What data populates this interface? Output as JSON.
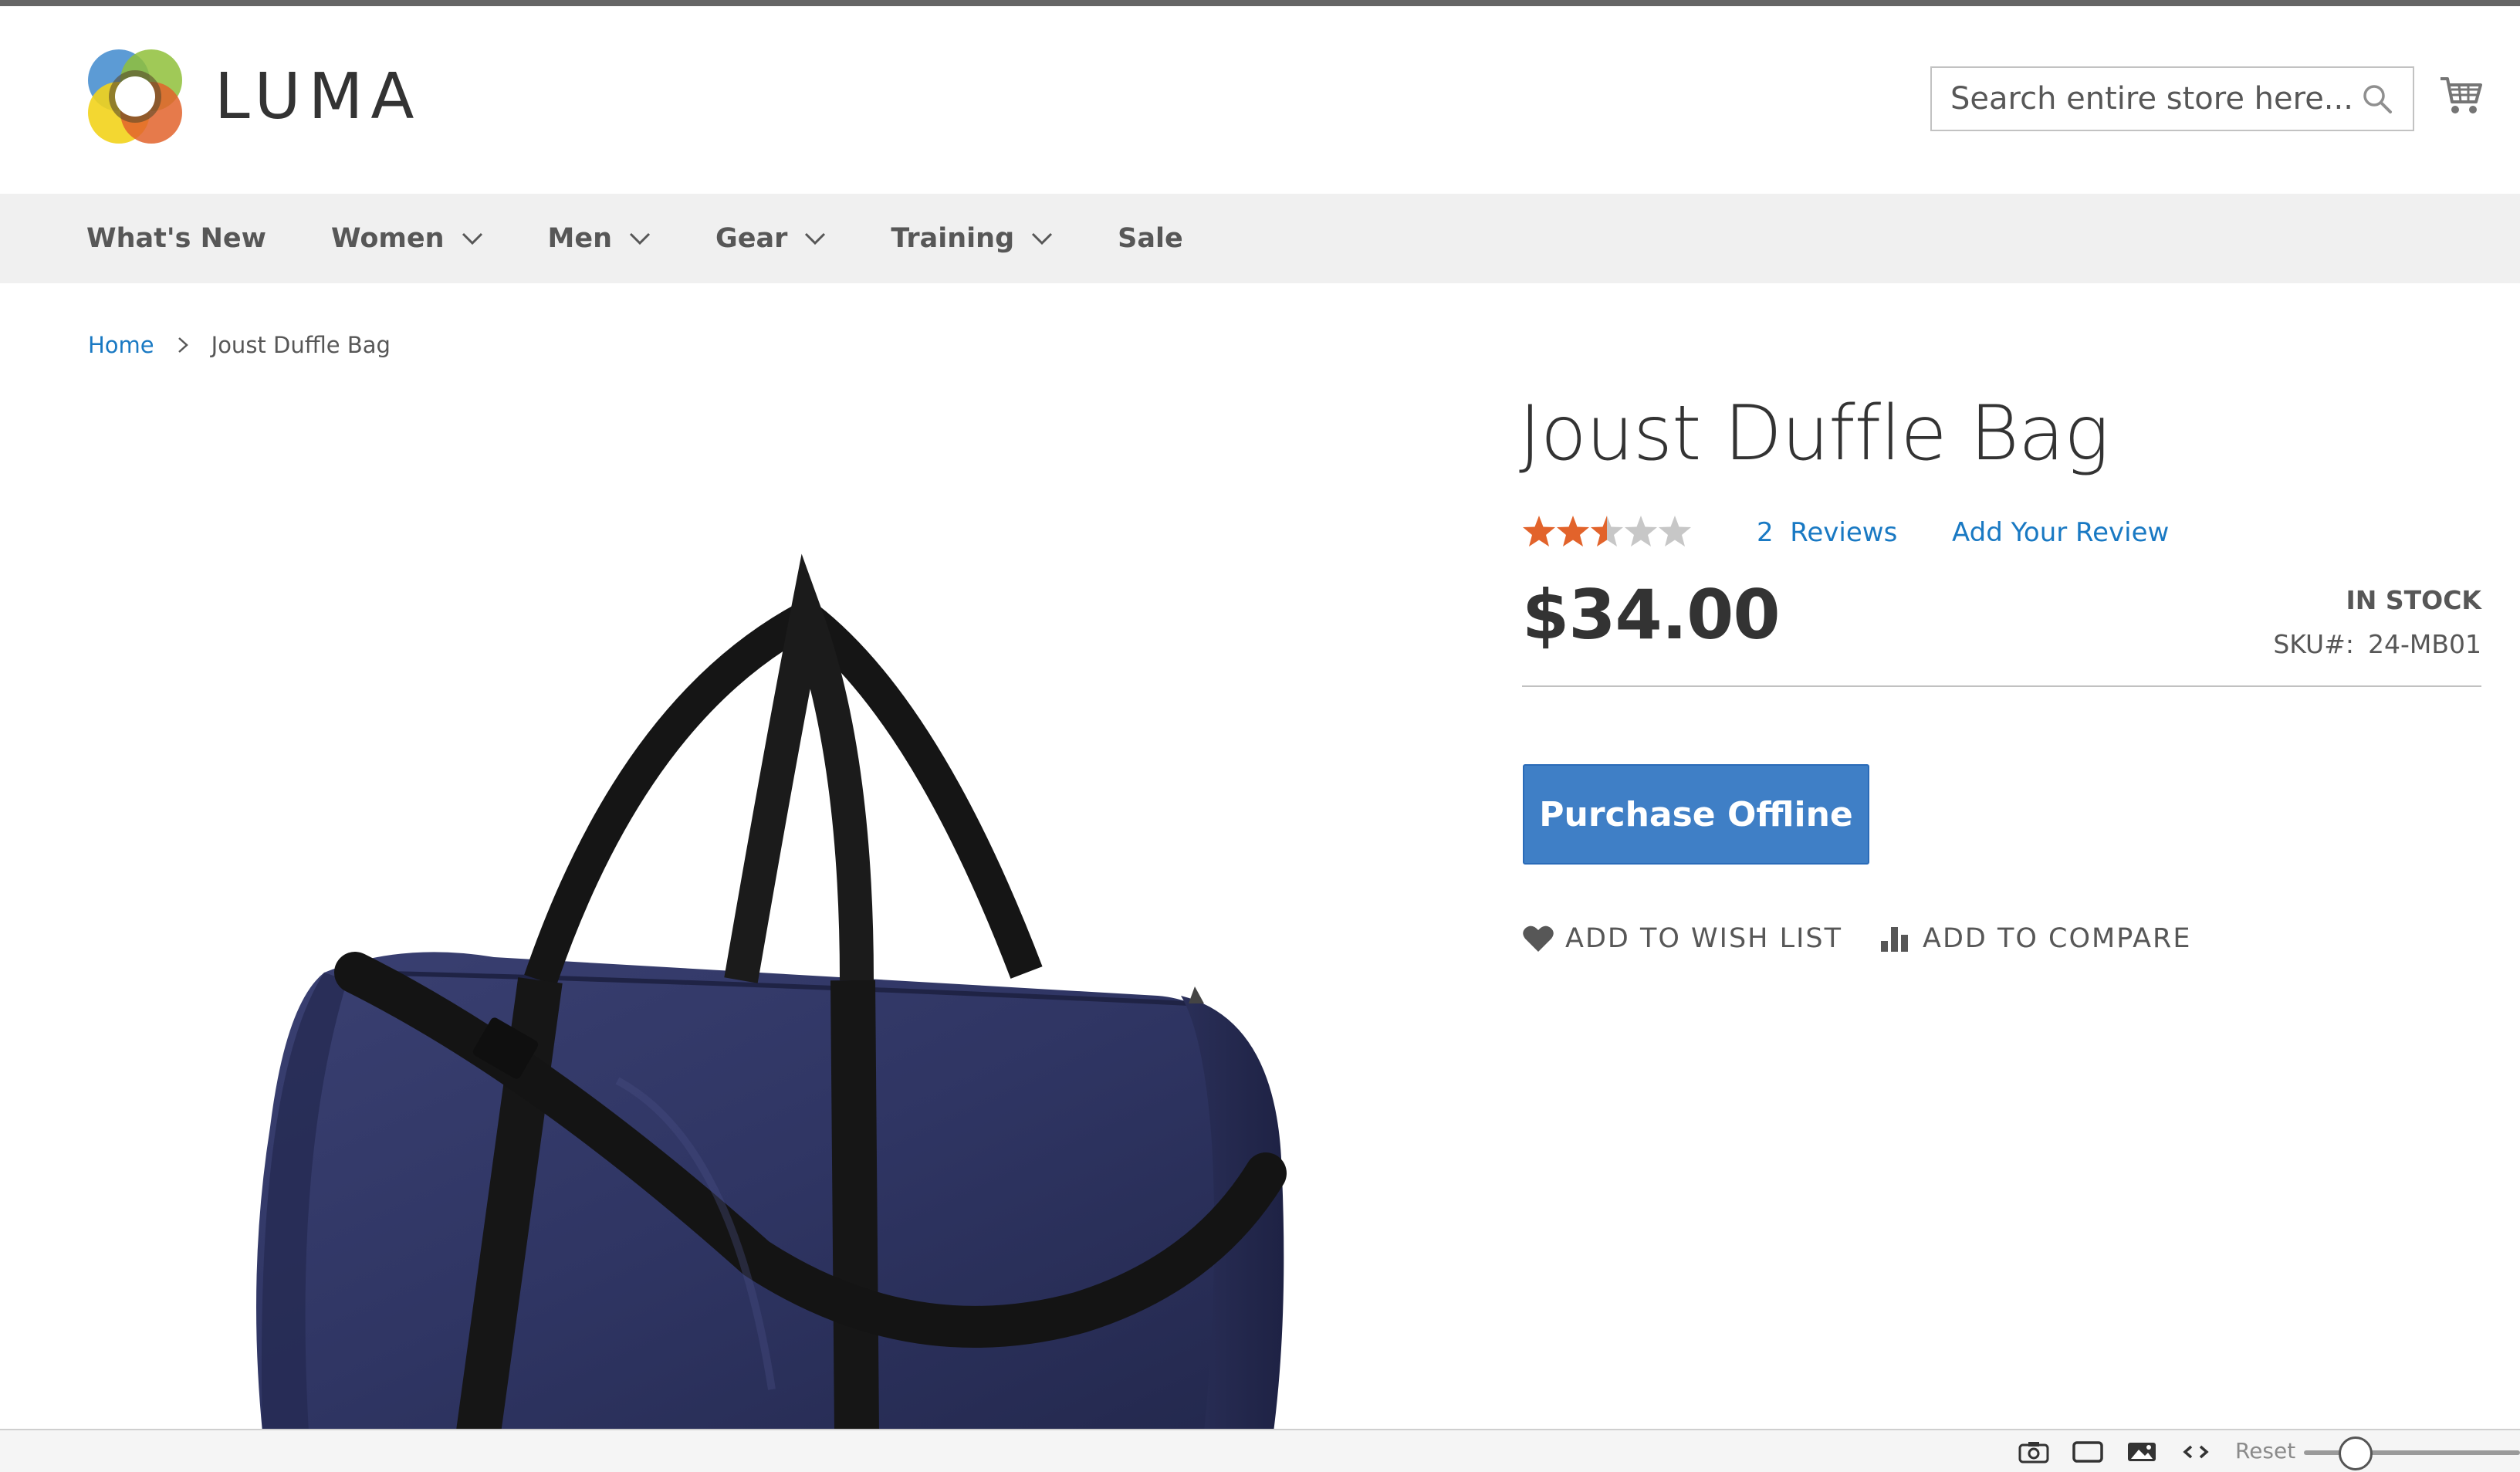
{
  "header": {
    "logo_text": "LUMA",
    "search_placeholder": "Search entire store here...",
    "cart_icon": "cart-icon",
    "search_icon": "search-icon"
  },
  "nav": {
    "items": [
      {
        "label": "What's New",
        "has_dropdown": false
      },
      {
        "label": "Women",
        "has_dropdown": true
      },
      {
        "label": "Men",
        "has_dropdown": true
      },
      {
        "label": "Gear",
        "has_dropdown": true
      },
      {
        "label": "Training",
        "has_dropdown": true
      },
      {
        "label": "Sale",
        "has_dropdown": false
      }
    ]
  },
  "breadcrumb": {
    "home": "Home",
    "current": "Joust Duffle Bag"
  },
  "product": {
    "title": "Joust Duffle Bag",
    "rating_stars": 2.5,
    "rating_max": 5,
    "reviews_count": "2",
    "reviews_label": "Reviews",
    "add_review": "Add Your Review",
    "price": "$34.00",
    "stock": "IN STOCK",
    "sku_label": "SKU#:",
    "sku_value": "24-MB01",
    "purchase_button": "Purchase Offline",
    "wishlist": "ADD TO WISH LIST",
    "compare": "ADD TO COMPARE"
  },
  "toolbar": {
    "reset_label": "Reset",
    "icons": [
      "camera-icon",
      "frame-icon",
      "image-icon",
      "code-icon"
    ]
  },
  "colors": {
    "link": "#1979c3",
    "button": "#3f7fc6",
    "star_filled": "#e2632b",
    "star_empty": "#c7c7c7",
    "nav_bg": "#f0f0f0",
    "bag": "#2f3563"
  }
}
